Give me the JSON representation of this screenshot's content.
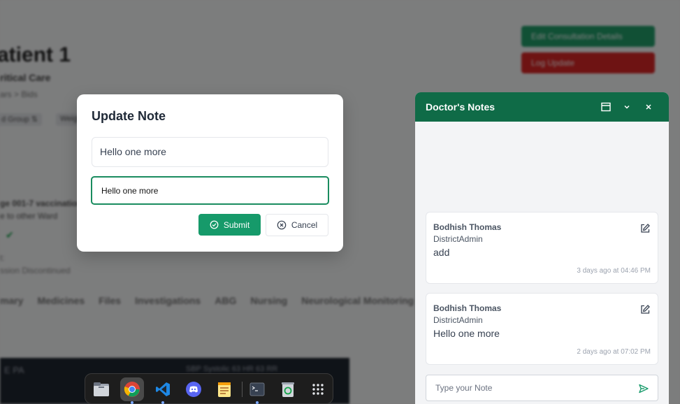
{
  "background": {
    "title": "atient 1",
    "subtitle": "ritical Care",
    "breadcrumb": "ars  >  Bids",
    "chips": [
      "d Group ⇅",
      "Weigh"
    ],
    "lines": [
      "ge 001-7 vaccination",
      "e to other Ward"
    ],
    "meta_lines": [
      "t:",
      "ssion Discontinued"
    ],
    "tabs": [
      "mary",
      "Medicines",
      "Files",
      "Investigations",
      "ABG",
      "Nursing",
      "Neurological Monitoring"
    ],
    "buttons": [
      "Edit Consultation Details",
      "Log Update"
    ],
    "dark_text": "E   PA",
    "dark_right": "SBP   Systolic 63     HR 63     RR"
  },
  "modal": {
    "title": "Update Note",
    "display_text": "Hello one more",
    "input_value": "Hello one more",
    "submit_label": "Submit",
    "cancel_label": "Cancel"
  },
  "panel": {
    "title": "Doctor's Notes",
    "notes": [
      {
        "author": "Bodhish Thomas",
        "role": "DistrictAdmin",
        "text": "add",
        "time": "3 days ago at 04:46 PM"
      },
      {
        "author": "Bodhish Thomas",
        "role": "DistrictAdmin",
        "text": "Hello one more",
        "time": "2 days ago at 07:02 PM"
      }
    ],
    "compose_placeholder": "Type your Note"
  },
  "dock": {
    "items": [
      "files-icon",
      "chrome-icon",
      "vscode-icon",
      "discord-icon",
      "text-editor-icon",
      "terminal-icon",
      "trash-icon",
      "app-grid-icon"
    ]
  },
  "colors": {
    "accent": "#169a6a",
    "panel_header": "#0f6b47"
  }
}
